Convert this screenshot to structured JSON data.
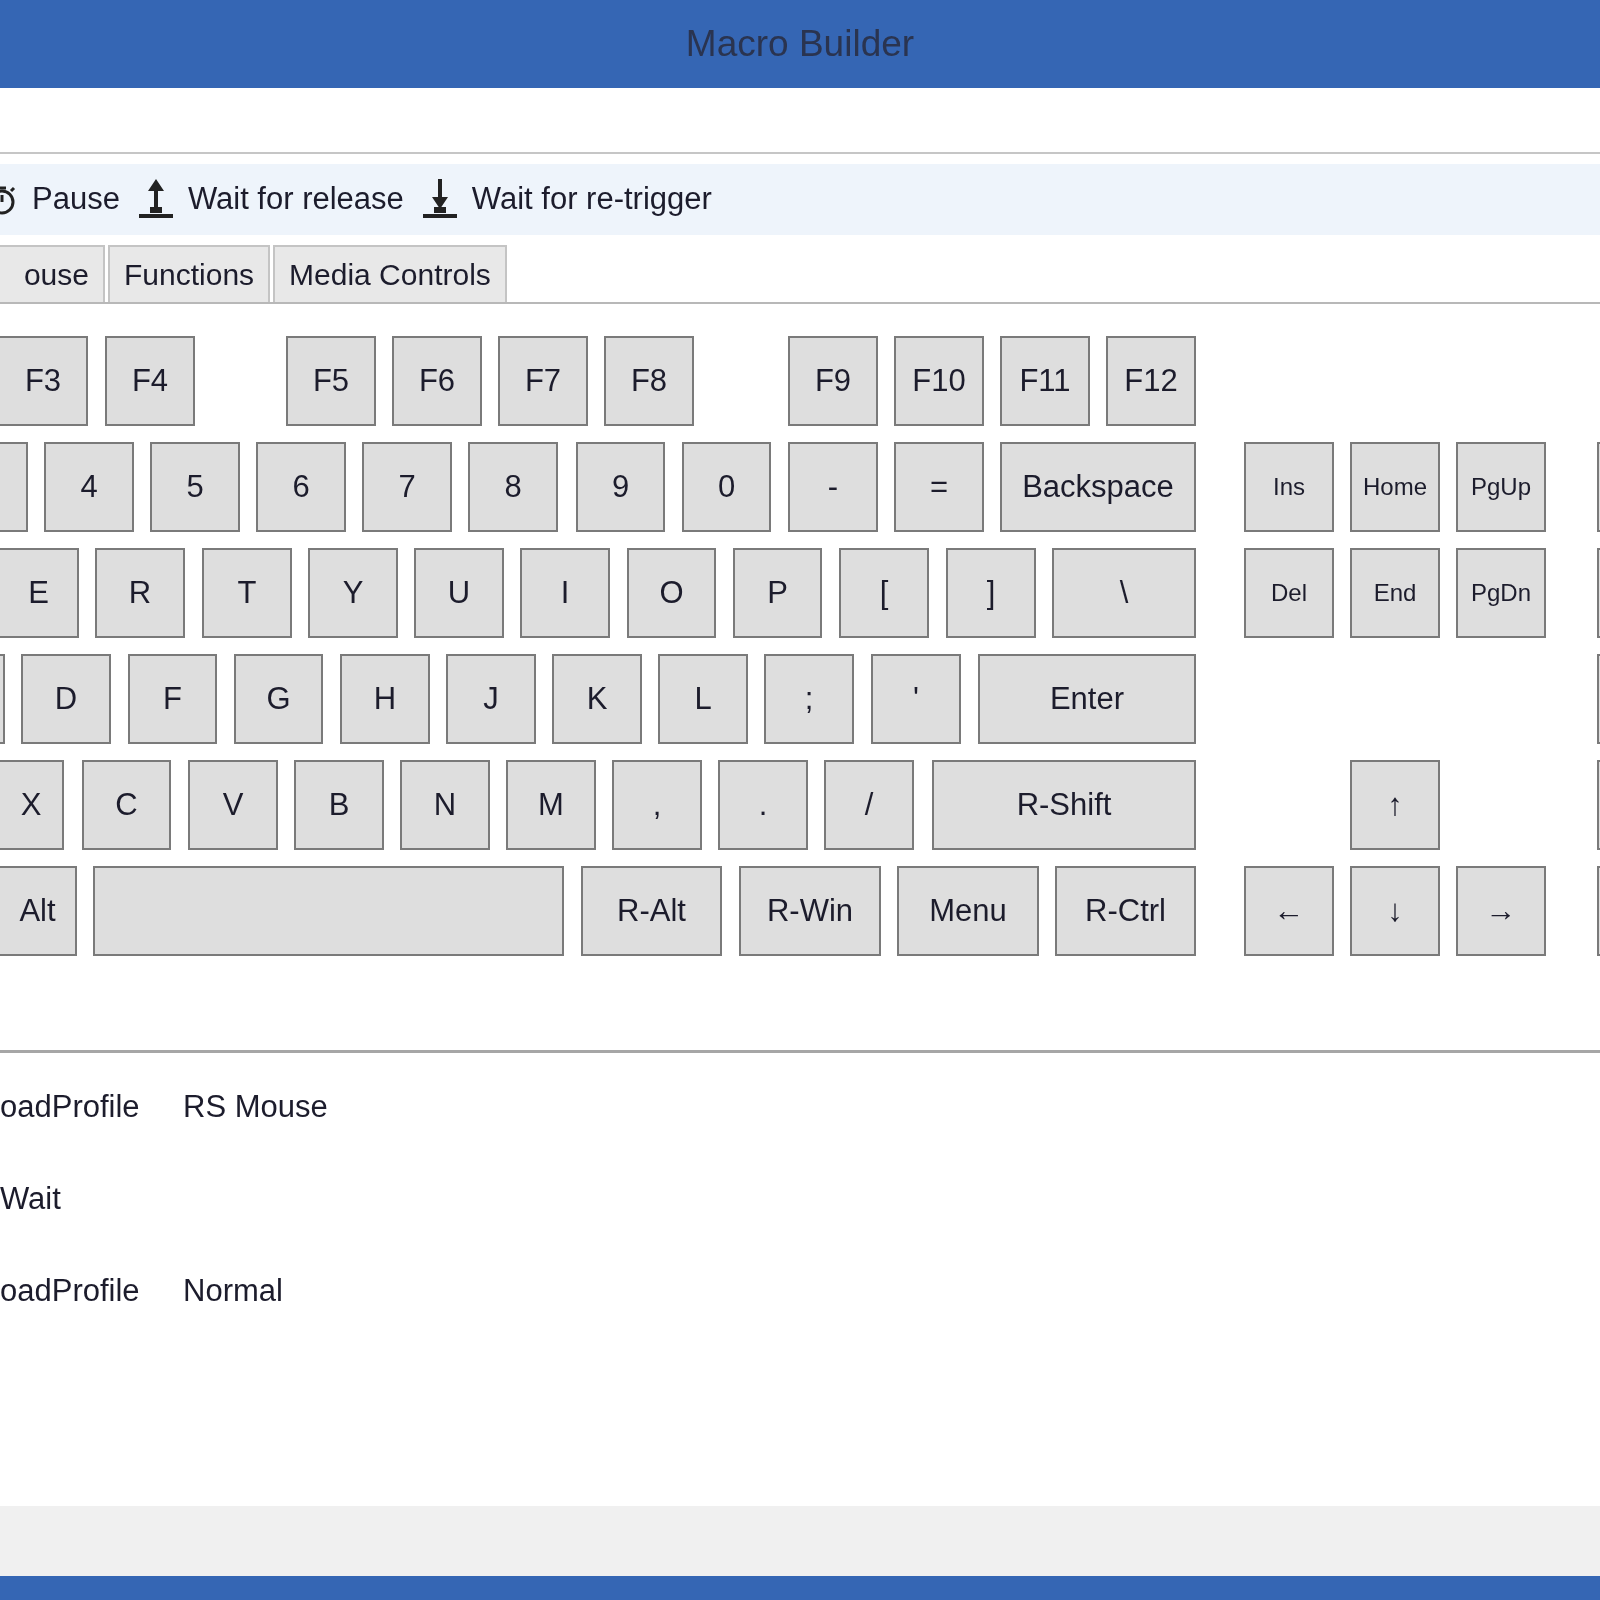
{
  "window": {
    "title": "Macro Builder"
  },
  "toolbar": [
    {
      "kind": "timer",
      "label": "Pause"
    },
    {
      "kind": "up",
      "label": "Wait for release"
    },
    {
      "kind": "down",
      "label": "Wait for re-trigger"
    }
  ],
  "tabs": [
    {
      "label": "ouse",
      "selected": false
    },
    {
      "label": "Functions",
      "selected": false
    },
    {
      "label": "Media Controls",
      "selected": false
    }
  ],
  "keyboard": {
    "rows": [
      {
        "keys": [
          {
            "kind": "key",
            "label": "F3"
          },
          {
            "kind": "key",
            "label": "F4"
          },
          {
            "kind": "key",
            "label": "F5"
          },
          {
            "kind": "key",
            "label": "F6"
          },
          {
            "kind": "key",
            "label": "F7"
          },
          {
            "kind": "key",
            "label": "F8"
          },
          {
            "kind": "key",
            "label": "F9"
          },
          {
            "kind": "key",
            "label": "F10"
          },
          {
            "kind": "key",
            "label": "F11"
          },
          {
            "kind": "key",
            "label": "F12"
          }
        ]
      },
      {
        "keys": [
          {
            "kind": "blank"
          },
          {
            "kind": "key",
            "label": "4"
          },
          {
            "kind": "key",
            "label": "5"
          },
          {
            "kind": "key",
            "label": "6"
          },
          {
            "kind": "key",
            "label": "7"
          },
          {
            "kind": "key",
            "label": "8"
          },
          {
            "kind": "key",
            "label": "9"
          },
          {
            "kind": "key",
            "label": "0"
          },
          {
            "kind": "key",
            "label": "-"
          },
          {
            "kind": "key",
            "label": "="
          },
          {
            "kind": "key",
            "label": "Backspace"
          },
          {
            "kind": "small",
            "label": "Ins"
          },
          {
            "kind": "small",
            "label": "Home"
          },
          {
            "kind": "small",
            "label": "PgUp"
          },
          {
            "kind": "blank"
          }
        ]
      },
      {
        "keys": [
          {
            "kind": "key",
            "label": "E"
          },
          {
            "kind": "key",
            "label": "R"
          },
          {
            "kind": "key",
            "label": "T"
          },
          {
            "kind": "key",
            "label": "Y"
          },
          {
            "kind": "key",
            "label": "U"
          },
          {
            "kind": "key",
            "label": "I"
          },
          {
            "kind": "key",
            "label": "O"
          },
          {
            "kind": "key",
            "label": "P"
          },
          {
            "kind": "key",
            "label": "["
          },
          {
            "kind": "key",
            "label": "]"
          },
          {
            "kind": "key",
            "label": "\\"
          },
          {
            "kind": "small",
            "label": "Del"
          },
          {
            "kind": "small",
            "label": "End"
          },
          {
            "kind": "small",
            "label": "PgDn"
          },
          {
            "kind": "blank"
          }
        ]
      },
      {
        "keys": [
          {
            "kind": "blank"
          },
          {
            "kind": "key",
            "label": "D"
          },
          {
            "kind": "key",
            "label": "F"
          },
          {
            "kind": "key",
            "label": "G"
          },
          {
            "kind": "key",
            "label": "H"
          },
          {
            "kind": "key",
            "label": "J"
          },
          {
            "kind": "key",
            "label": "K"
          },
          {
            "kind": "key",
            "label": "L"
          },
          {
            "kind": "key",
            "label": ";"
          },
          {
            "kind": "key",
            "label": "'"
          },
          {
            "kind": "key",
            "label": "Enter"
          },
          {
            "kind": "blank"
          }
        ]
      },
      {
        "keys": [
          {
            "kind": "key",
            "label": "X"
          },
          {
            "kind": "key",
            "label": "C"
          },
          {
            "kind": "key",
            "label": "V"
          },
          {
            "kind": "key",
            "label": "B"
          },
          {
            "kind": "key",
            "label": "N"
          },
          {
            "kind": "key",
            "label": "M"
          },
          {
            "kind": "key",
            "label": ","
          },
          {
            "kind": "key",
            "label": "."
          },
          {
            "kind": "key",
            "label": "/"
          },
          {
            "kind": "key",
            "label": "R-Shift"
          },
          {
            "kind": "key",
            "label": "↑"
          },
          {
            "kind": "blank"
          }
        ]
      },
      {
        "keys": [
          {
            "kind": "key",
            "label": "Alt"
          },
          {
            "kind": "blank"
          },
          {
            "kind": "key",
            "label": "R-Alt"
          },
          {
            "kind": "key",
            "label": "R-Win"
          },
          {
            "kind": "key",
            "label": "Menu"
          },
          {
            "kind": "key",
            "label": "R-Ctrl"
          },
          {
            "kind": "key",
            "label": "←"
          },
          {
            "kind": "key",
            "label": "↓"
          },
          {
            "kind": "key",
            "label": "→"
          },
          {
            "kind": "blank"
          }
        ]
      }
    ]
  },
  "macro_steps": [
    {
      "action": "oadProfile",
      "value": "RS Mouse"
    },
    {
      "action": "Wait"
    },
    {
      "action": "oadProfile",
      "value": "Normal"
    }
  ]
}
